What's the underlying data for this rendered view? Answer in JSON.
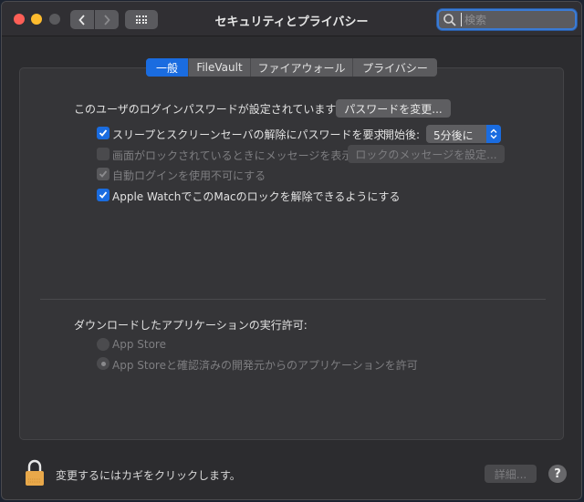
{
  "window": {
    "title": "セキュリティとプライバシー",
    "search_placeholder": "検索",
    "search_value": ""
  },
  "tabs": [
    {
      "label": "一般",
      "active": true
    },
    {
      "label": "FileVault",
      "active": false
    },
    {
      "label": "ファイアウォール",
      "active": false
    },
    {
      "label": "プライバシー",
      "active": false
    }
  ],
  "general": {
    "password_status": "このユーザのログインパスワードが設定されています",
    "change_password_button": "パスワードを変更...",
    "require_password": {
      "label": "スリープとスクリーンセーバの解除にパスワードを要求",
      "checked": true
    },
    "start_after_label": "開始後:",
    "start_after_value": "5分後に",
    "show_message": {
      "label": "画面がロックされているときにメッセージを表示",
      "checked": false,
      "disabled": true
    },
    "set_lock_message_button": "ロックのメッセージを設定...",
    "disable_auto_login": {
      "label": "自動ログインを使用不可にする",
      "checked": true,
      "disabled": true
    },
    "apple_watch_unlock": {
      "label": "Apple WatchでこのMacのロックを解除できるようにする",
      "checked": true
    }
  },
  "downloads": {
    "heading": "ダウンロードしたアプリケーションの実行許可:",
    "options": [
      {
        "label": "App Store",
        "selected": false
      },
      {
        "label": "App Storeと確認済みの開発元からのアプリケーションを許可",
        "selected": true
      }
    ]
  },
  "footer": {
    "lock_message": "変更するにはカギをクリックします。",
    "advanced_button": "詳細...",
    "help_label": "?"
  },
  "colors": {
    "accent": "#1a6ce0",
    "window_bg": "#2c2c2f",
    "panel_bg": "#353538"
  }
}
